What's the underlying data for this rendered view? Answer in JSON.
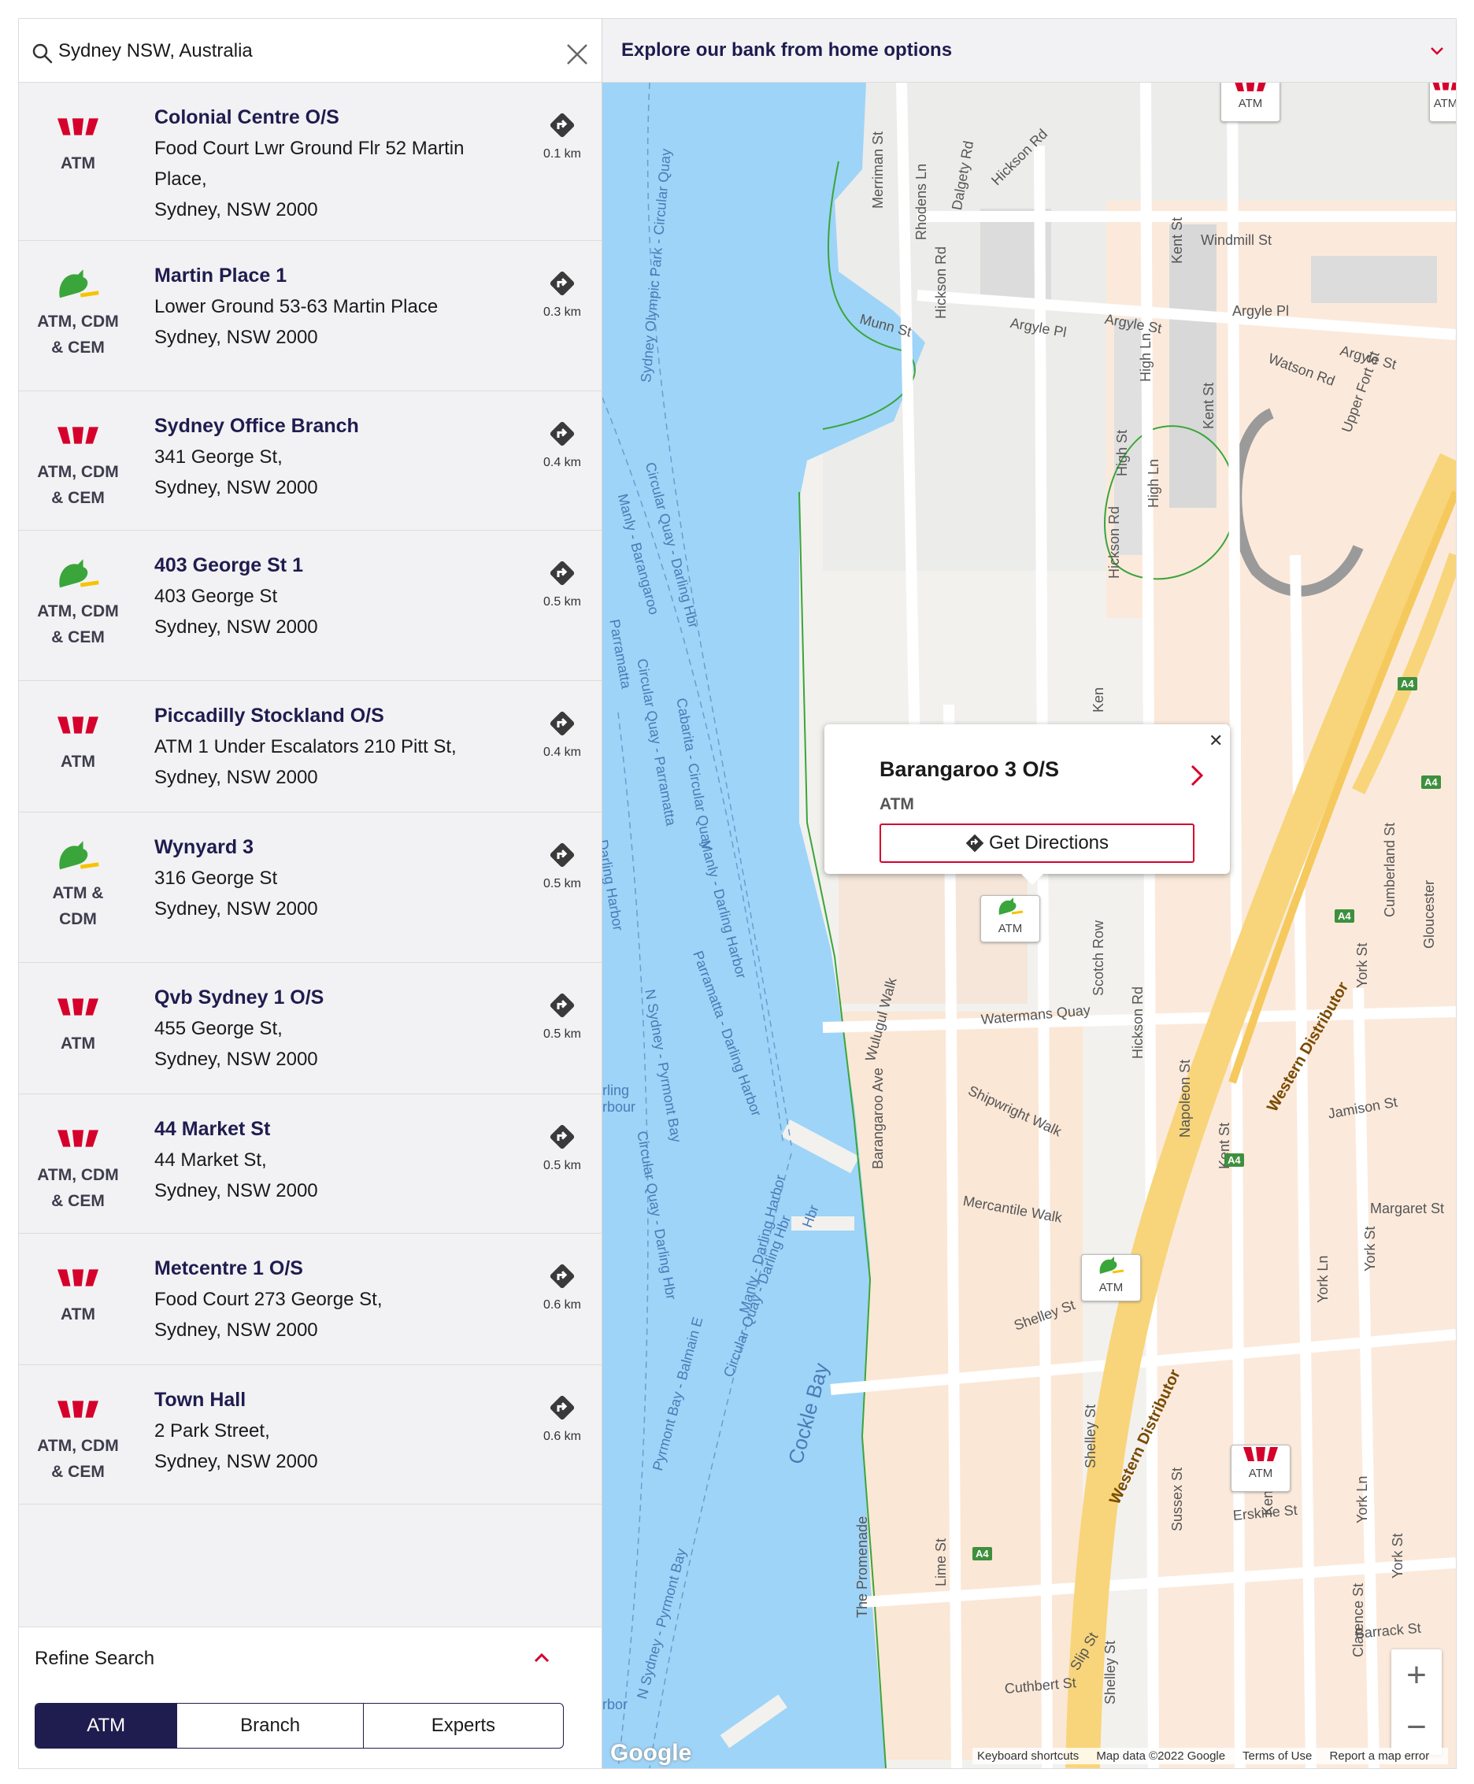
{
  "search": {
    "value": "Sydney NSW, Australia"
  },
  "header": {
    "title": "Explore our bank from home options"
  },
  "locations": [
    {
      "name": "Colonial Centre O/S",
      "address": "Food Court Lwr Ground Flr 52 Martin Place,\nSydney, NSW 2000",
      "type": "ATM",
      "brand": "westpac",
      "distance": "0.1 km"
    },
    {
      "name": "Martin Place 1",
      "address": "Lower Ground 53-63 Martin Place\nSydney, NSW 2000",
      "type": "ATM, CDM\n& CEM",
      "brand": "stgeorge",
      "distance": "0.3 km"
    },
    {
      "name": "Sydney Office Branch",
      "address": "341 George St,\nSydney, NSW 2000",
      "type": "ATM, CDM\n& CEM",
      "brand": "westpac",
      "distance": "0.4 km"
    },
    {
      "name": "403 George St 1",
      "address": "403 George St\nSydney, NSW 2000",
      "type": "ATM, CDM\n& CEM",
      "brand": "stgeorge",
      "distance": "0.5 km"
    },
    {
      "name": "Piccadilly Stockland O/S",
      "address": "ATM 1 Under Escalators 210 Pitt St,\nSydney, NSW 2000",
      "type": "ATM",
      "brand": "westpac",
      "distance": "0.4 km"
    },
    {
      "name": "Wynyard 3",
      "address": "316 George St\nSydney, NSW 2000",
      "type": "ATM &\nCDM",
      "brand": "stgeorge",
      "distance": "0.5 km"
    },
    {
      "name": "Qvb Sydney 1 O/S",
      "address": "455 George St,\nSydney, NSW 2000",
      "type": "ATM",
      "brand": "westpac",
      "distance": "0.5 km"
    },
    {
      "name": "44 Market St",
      "address": "44 Market St,\nSydney, NSW 2000",
      "type": "ATM, CDM\n& CEM",
      "brand": "westpac",
      "distance": "0.5 km"
    },
    {
      "name": "Metcentre 1 O/S",
      "address": "Food Court 273 George St,\nSydney, NSW 2000",
      "type": "ATM",
      "brand": "westpac",
      "distance": "0.6 km"
    },
    {
      "name": "Town Hall",
      "address": "2 Park Street,\nSydney, NSW 2000",
      "type": "ATM, CDM\n& CEM",
      "brand": "westpac",
      "distance": "0.6 km"
    }
  ],
  "refine": {
    "label": "Refine Search"
  },
  "filters": {
    "atm": "ATM",
    "branch": "Branch",
    "experts": "Experts",
    "active": "ATM"
  },
  "popup": {
    "title": "Barangaroo 3 O/S",
    "type": "ATM",
    "button": "Get Directions"
  },
  "marker_label": "ATM",
  "map": {
    "streets": [
      "Merriman St",
      "Rhodens Ln",
      "Dalgety Rd",
      "Hickson Rd",
      "Windmill St",
      "Munn St",
      "Argyle Pl",
      "Argyle St",
      "Argyle Pl",
      "Argyle St",
      "Watson Rd",
      "Kent St",
      "Hickson Rd",
      "High Ln",
      "Kent St",
      "High St",
      "High Ln",
      "Upper Fort St",
      "Hickson Rd",
      "Barangaroo Ave",
      "Kent St",
      "Watermans Quay",
      "Scotch Row",
      "Hickson Rd",
      "Wulugul Walk",
      "Shipwright Walk",
      "Barangaroo Ave",
      "Mercantile Walk",
      "Napoleon St",
      "Kent St",
      "Jamison St",
      "Margaret St",
      "York St",
      "York Ln",
      "Shelley St",
      "Shelley St",
      "Sussex St",
      "Erskine St",
      "Kent St",
      "York Ln",
      "York St",
      "Lime St",
      "The Promenade",
      "Cuthbert St",
      "Slip St",
      "Clarence St",
      "Barrack St",
      "Shelley St",
      "Cumberland St",
      "Gloucester",
      "York St",
      "Western Distributor",
      "Western Distributor",
      "Ken",
      "St"
    ],
    "water_labels": [
      "Sydney Olympic Park - Circular Quay",
      "Circular Quay - Darling Hbr",
      "Manly - Barangaroo",
      "Parramatta",
      "Circular Quay - Parramatta",
      "Cabarita - Circular Quay",
      "Manly - Darling Harbor",
      "Parramatta - Darling Harbor",
      "N Sydney - Pyrmont Bay",
      "Circular Quay - Darling Hbr",
      "Darling Harbor",
      "rling\nrbour",
      "Manly - Darling Harbor",
      "Pyrmont Bay - Balmain E",
      "Circular Quay - Darling Hbr",
      "Cockle Bay",
      "N Sydney - Pyrmont Bay",
      "rbor",
      "Hbr"
    ],
    "road_badges": [
      "A4",
      "A4",
      "A4",
      "A4",
      "A4"
    ],
    "attribution": [
      "Keyboard shortcuts",
      "Map data ©2022 Google",
      "Terms of Use",
      "Report a map error"
    ],
    "logo": "Google"
  },
  "colors": {
    "brand_red": "#d5002b",
    "navy": "#1f1c4f",
    "water": "#9ed4f7",
    "road_major": "#f8d57a",
    "stgeorge_green": "#3aa53a"
  }
}
